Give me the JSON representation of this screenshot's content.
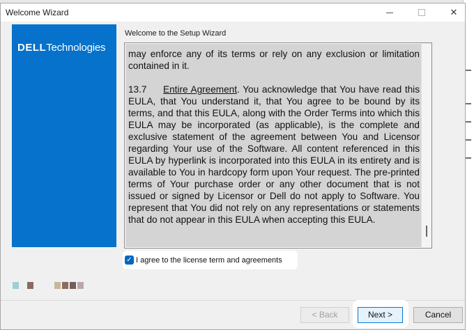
{
  "window": {
    "title": "Welcome Wizard",
    "minimize_label": "—",
    "maximize_label": "☐",
    "close_label": "✕"
  },
  "brand": {
    "logo_dell": "DELL",
    "logo_technologies": "Technologies",
    "panel_color": "#0672cb"
  },
  "wizard": {
    "heading": "Welcome to the Setup Wizard",
    "eula": {
      "p1": "may enforce any of its terms or rely on any exclusion or limitation contained in it.",
      "p2_number": "13.7",
      "p2_title": "Entire Agreement",
      "p2_body": ". You acknowledge that You have read this EULA, that You understand it, that You agree to be bound by its terms, and that this EULA, along with the Order Terms into which this EULA may be incorporated (as applicable), is the complete and exclusive statement of the agreement between You and Licensor regarding Your use of the Software. All content referenced in this EULA by hyperlink is incorporated into this EULA in its entirety and is available to You in hardcopy form upon Your request. The pre-printed terms of Your purchase order or any other document that is not issued or signed by Licensor or Dell do not apply to Software. You represent that You did not rely on any representations or statements that do not appear in this EULA when accepting this EULA."
    },
    "agree": {
      "checked": true,
      "check_glyph": "✓",
      "label": "I agree to the license term and agreements"
    }
  },
  "buttons": {
    "back": "< Back",
    "next": "Next >",
    "cancel": "Cancel"
  },
  "colors": {
    "accent": "#0067c0",
    "swatches": [
      "#9ecfd3",
      "#8a6a63",
      "#c8b79a",
      "#8c6d5e",
      "#7a5a5a",
      "#b9a7ad"
    ]
  }
}
